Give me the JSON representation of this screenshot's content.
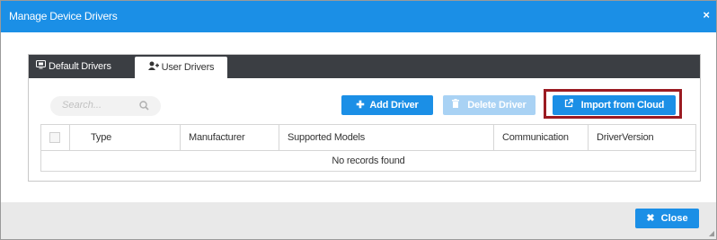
{
  "dialog": {
    "title": "Manage Device Drivers",
    "close_glyph": "×"
  },
  "tabs": [
    {
      "label": "Default Drivers",
      "icon": "monitor-icon",
      "active": false
    },
    {
      "label": "User Drivers",
      "icon": "user-add-icon",
      "active": true
    }
  ],
  "toolbar": {
    "search_placeholder": "Search...",
    "add_label": "Add Driver",
    "delete_label": "Delete Driver",
    "import_label": "Import from Cloud"
  },
  "table": {
    "columns": [
      "Type",
      "Manufacturer",
      "Supported Models",
      "Communication",
      "DriverVersion"
    ],
    "empty_message": "No records found"
  },
  "footer": {
    "close_label": "Close"
  },
  "colors": {
    "accent": "#1b8fe6",
    "accent_disabled": "#a9d2f4",
    "tabbar": "#3b3e43",
    "highlight_box": "#9b1b22",
    "footer": "#e9e9e9"
  }
}
